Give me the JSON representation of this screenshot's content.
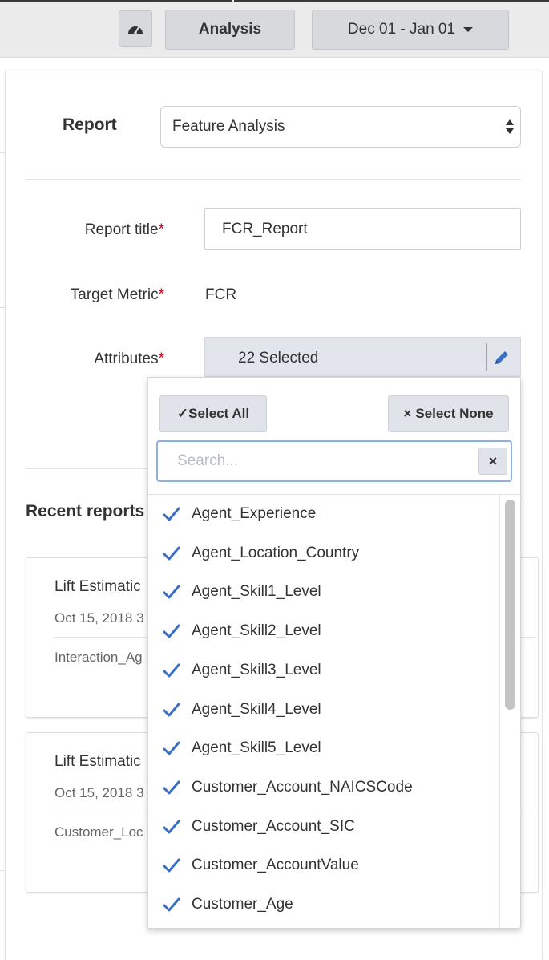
{
  "topbar": {
    "dashboard_icon": "speedometer-icon",
    "analysis_label": "Analysis",
    "date_range": "Dec 01 - Jan 01"
  },
  "form": {
    "report_label": "Report",
    "report_value": "Feature Analysis",
    "report_title_label": "Report title",
    "report_title_value": "FCR_Report",
    "target_metric_label": "Target Metric",
    "target_metric_value": "FCR",
    "attributes_label": "Attributes",
    "attributes_value": "22 Selected",
    "required_mark": "*"
  },
  "dropdown": {
    "select_all_label": "Select All",
    "select_none_label": "Select None",
    "search_placeholder": "Search...",
    "clear_label": "×",
    "items": [
      "Agent_Experience",
      "Agent_Location_Country",
      "Agent_Skill1_Level",
      "Agent_Skill2_Level",
      "Agent_Skill3_Level",
      "Agent_Skill4_Level",
      "Agent_Skill5_Level",
      "Customer_Account_NAICSCode",
      "Customer_Account_SIC",
      "Customer_AccountValue",
      "Customer_Age"
    ]
  },
  "recent": {
    "title": "Recent reports",
    "cards": [
      {
        "title": "Lift Estimatic",
        "date": "Oct 15, 2018 3",
        "subtitle": "Interaction_Ag"
      },
      {
        "title": "Lift Estimatic",
        "date": "Oct 15, 2018 3",
        "subtitle": "Customer_Loc"
      }
    ]
  },
  "colors": {
    "accent": "#3b6fc4",
    "required": "#d0021b"
  }
}
